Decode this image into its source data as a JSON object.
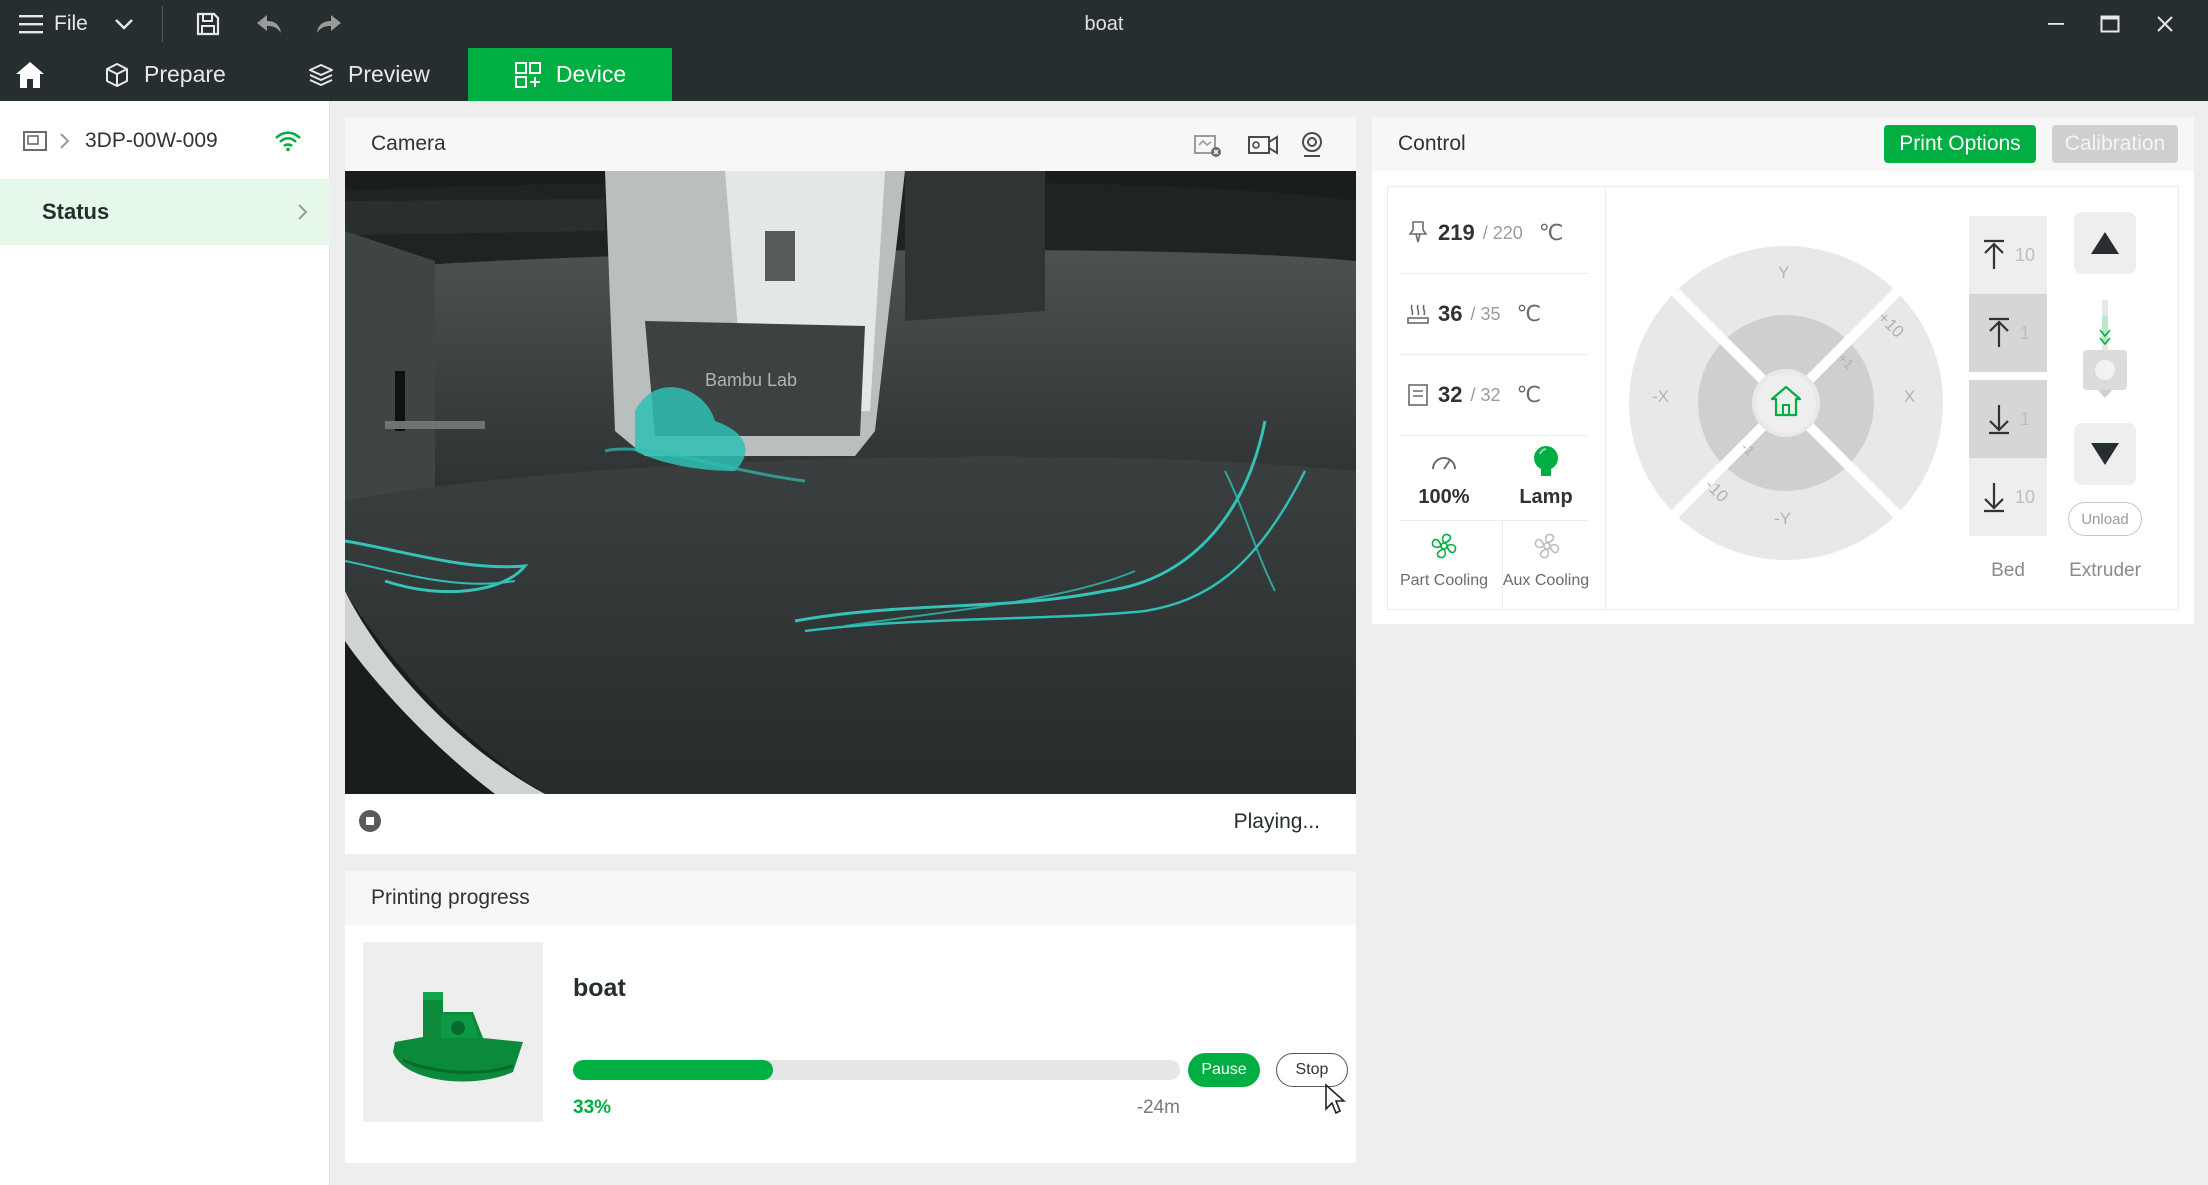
{
  "window": {
    "title": "boat",
    "file_menu": "File"
  },
  "tabs": [
    {
      "label": "Prepare"
    },
    {
      "label": "Preview"
    },
    {
      "label": "Device"
    }
  ],
  "sidebar": {
    "device_name": "3DP-00W-009",
    "status_label": "Status"
  },
  "camera": {
    "title": "Camera",
    "playback_status": "Playing..."
  },
  "progress": {
    "title": "Printing progress",
    "job_name": "boat",
    "percent_label": "33%",
    "percent_value": 33,
    "remaining": "-24m",
    "pause_label": "Pause",
    "stop_label": "Stop"
  },
  "control": {
    "title": "Control",
    "print_options_label": "Print Options",
    "calibration_label": "Calibration",
    "nozzle": {
      "current": "219",
      "target": "/ 220",
      "unit": "℃"
    },
    "bed": {
      "current": "36",
      "target": "/ 35",
      "unit": "℃"
    },
    "chamber": {
      "current": "32",
      "target": "/ 32",
      "unit": "℃"
    },
    "speed_label": "100%",
    "lamp_label": "Lamp",
    "part_cooling_label": "Part Cooling",
    "aux_cooling_label": "Aux Cooling",
    "jog": {
      "y_plus": "Y",
      "y_minus": "-Y",
      "x_plus": "X",
      "x_minus": "-X",
      "plus10": "+10",
      "plus1": "+1",
      "minus1": "-1",
      "minus10": "-10"
    },
    "bed_steps": {
      "up10": "10",
      "up1": "1",
      "down1": "1",
      "down10": "10"
    },
    "bed_label": "Bed",
    "extruder_label": "Extruder",
    "unload_label": "Unload"
  },
  "colors": {
    "accent": "#00ae42",
    "titlebar": "#262e30",
    "filament": "#2fbfb5",
    "model": "#0a8a3a"
  }
}
